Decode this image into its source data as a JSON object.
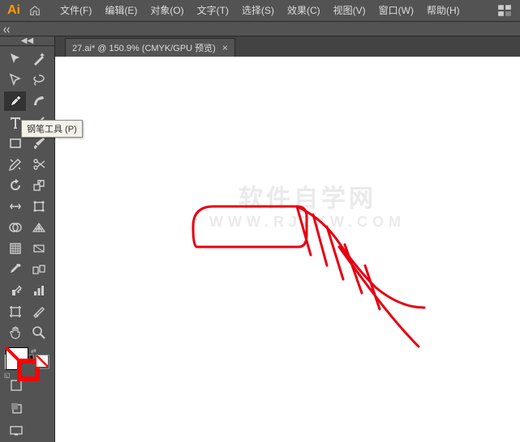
{
  "app": {
    "name": "Ai"
  },
  "menu": {
    "file": "文件(F)",
    "edit": "编辑(E)",
    "object": "对象(O)",
    "type": "文字(T)",
    "select": "选择(S)",
    "effect": "效果(C)",
    "view": "视图(V)",
    "window": "窗口(W)",
    "help": "帮助(H)"
  },
  "tab": {
    "label": "27.ai* @ 150.9%  (CMYK/GPU 预览)",
    "close": "×"
  },
  "tooltip": {
    "pen": "钢笔工具 (P)"
  },
  "colors": {
    "stroke": "#ff0000",
    "fill": "none"
  },
  "watermark": {
    "main": "软件自学网",
    "sub": "WWW.RJZXW.COM"
  },
  "tools": {
    "selection": "selection",
    "direct": "direct-selection",
    "pen": "pen",
    "curvature": "curvature",
    "text": "text",
    "line": "line",
    "rect": "rectangle",
    "brush": "paintbrush",
    "pencil": "pencil",
    "eraser": "eraser",
    "rotate": "rotate",
    "scale": "scale",
    "width": "width",
    "free": "free-transform",
    "shape": "shape-builder",
    "perspective": "perspective",
    "mesh": "mesh",
    "gradient": "gradient",
    "eyedrop": "eyedropper",
    "blend": "blend",
    "symbol": "symbol-sprayer",
    "graph": "graph",
    "artboard": "artboard",
    "slice": "slice",
    "hand": "hand",
    "zoom": "zoom"
  }
}
